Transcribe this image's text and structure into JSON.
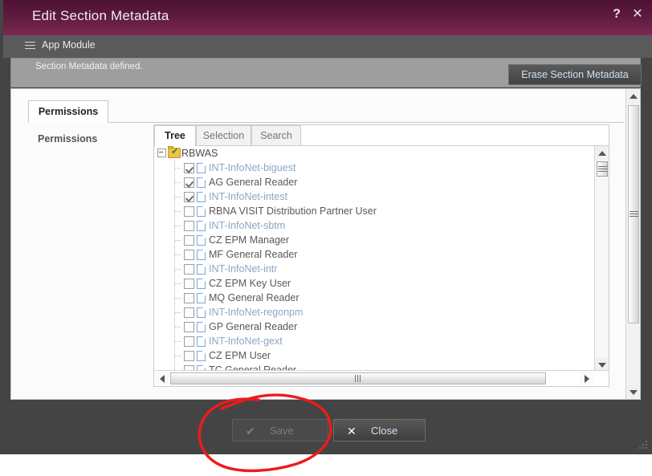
{
  "window": {
    "title": "Edit Section Metadata",
    "help_icon": "?",
    "close_icon": "✕"
  },
  "module_bar": {
    "label": "App Module",
    "menu_icon": "hamburger-icon"
  },
  "message_bar": {
    "text": "Section Metadata defined.",
    "erase_button": "Erase Section Metadata"
  },
  "permissions_panel": {
    "tab_label": "Permissions",
    "field_label": "Permissions"
  },
  "tree_widget": {
    "tabs": [
      {
        "label": "Tree",
        "active": true
      },
      {
        "label": "Selection",
        "active": false
      },
      {
        "label": "Search",
        "active": false
      }
    ],
    "root": {
      "label": "RBWAS",
      "expander_icon": "collapse-icon",
      "folder_icon": "folder-checked-icon",
      "checked": true
    },
    "nodes": [
      {
        "label": "INT-InfoNet-biguest",
        "checked": true,
        "tone": "blue"
      },
      {
        "label": "AG General Reader",
        "checked": true,
        "tone": "dark"
      },
      {
        "label": "INT-InfoNet-intest",
        "checked": true,
        "tone": "blue"
      },
      {
        "label": "RBNA VISIT Distribution Partner User",
        "checked": false,
        "tone": "dark"
      },
      {
        "label": "INT-InfoNet-sbtm",
        "checked": false,
        "tone": "blue"
      },
      {
        "label": "CZ EPM Manager",
        "checked": false,
        "tone": "dark"
      },
      {
        "label": "MF General Reader",
        "checked": false,
        "tone": "dark"
      },
      {
        "label": "INT-InfoNet-intr",
        "checked": false,
        "tone": "blue"
      },
      {
        "label": "CZ EPM Key User",
        "checked": false,
        "tone": "dark"
      },
      {
        "label": "MQ General Reader",
        "checked": false,
        "tone": "dark"
      },
      {
        "label": "INT-InfoNet-regonpm",
        "checked": false,
        "tone": "blue"
      },
      {
        "label": "GP General Reader",
        "checked": false,
        "tone": "dark"
      },
      {
        "label": "INT-InfoNet-gext",
        "checked": false,
        "tone": "blue"
      },
      {
        "label": "CZ EPM User",
        "checked": false,
        "tone": "dark"
      },
      {
        "label": "TC General Reader",
        "checked": false,
        "tone": "dark"
      }
    ]
  },
  "footer": {
    "save_label": "Save",
    "save_icon": "✔",
    "save_enabled": false,
    "close_label": "Close",
    "close_icon": "✕"
  },
  "annotation": {
    "shape": "hand-drawn-ellipse",
    "color": "#ee1b1b",
    "target": "save-button"
  },
  "colors": {
    "titlebar": "#5d1a3c",
    "dialog_chrome": "#444444",
    "message_bar": "#9e9e9e",
    "link_text": "#cfe0f2",
    "annotation": "#ee1b1b"
  }
}
